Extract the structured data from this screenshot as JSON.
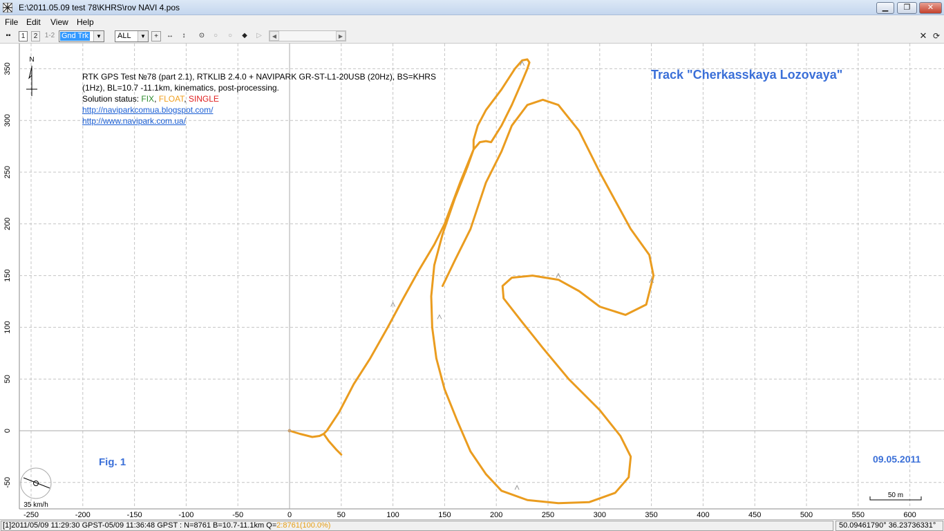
{
  "window": {
    "title": "E:\\2011.05.09 test 78\\KHRS\\rov NAVI 4.pos",
    "icon": "rtkplot-app-icon"
  },
  "menu": {
    "items": [
      "File",
      "Edit",
      "View",
      "Help"
    ]
  },
  "toolbar": {
    "btn1": "1",
    "btn2": "2",
    "btn12": "1-2",
    "plot_type": "Gnd Trk",
    "quality_filter": "ALL",
    "icons": [
      "connect-icon",
      "center-origin-icon",
      "fit-horizontal-icon",
      "fit-vertical-icon",
      "show-track-icon",
      "point-icon",
      "point-icon",
      "point-icon",
      "play-icon"
    ],
    "right_icons": [
      "close-icon",
      "refresh-icon"
    ]
  },
  "annotations": {
    "header_line1": "RTK GPS Test №78 (part 2.1), RTKLIB 2.4.0 + NAVIPARK GR-ST-L1-20USB (20Hz), BS=KHRS",
    "header_line2": "(1Hz), BL=10.7 -11.1km, kinematics, post-processing.",
    "status_label": "Solution status: ",
    "status_fix": "FIX",
    "status_sep1": ", ",
    "status_float": "FLOAT",
    "status_sep2": ", ",
    "status_single": "SINGLE",
    "link1": "http://naviparkcomua.blogspot.com/",
    "link2": "http://www.navipark.com.ua/",
    "track_title": "Track \"Cherkasskaya Lozovaya\"",
    "fig_label": "Fig. 1",
    "date": "09.05.2011",
    "north": "N",
    "speed": "35 km/h",
    "scale": "50 m"
  },
  "colors": {
    "fix": "#2e8b2e",
    "float": "#f0a020",
    "single": "#e02020",
    "track": "#ea9c1f",
    "accent_text": "#3a6fd8",
    "grid": "#c4c4c4"
  },
  "chart_data": {
    "type": "scatter",
    "xlim": [
      -250,
      650
    ],
    "ylim": [
      -70,
      365
    ],
    "x_ticks": [
      -250,
      -200,
      -150,
      -100,
      -50,
      0,
      50,
      100,
      150,
      200,
      250,
      300,
      350,
      400,
      450,
      500,
      550,
      600
    ],
    "y_ticks": [
      -50,
      0,
      50,
      100,
      150,
      200,
      250,
      300,
      350
    ],
    "grid": true,
    "series": [
      {
        "points": [
          [
            0,
            0
          ],
          [
            10,
            -3
          ],
          [
            22,
            -6
          ],
          [
            29,
            -5
          ],
          [
            33,
            -3
          ],
          [
            36,
            0
          ],
          [
            48,
            18
          ],
          [
            62,
            45
          ],
          [
            78,
            70
          ],
          [
            95,
            100
          ],
          [
            110,
            128
          ],
          [
            125,
            155
          ],
          [
            140,
            180
          ],
          [
            150,
            200
          ],
          [
            165,
            240
          ],
          [
            178,
            272
          ],
          [
            184,
            279
          ],
          [
            190,
            280
          ],
          [
            195,
            279
          ],
          [
            205,
            295
          ],
          [
            215,
            315
          ],
          [
            225,
            338
          ],
          [
            230,
            350
          ],
          [
            232,
            356
          ],
          [
            230,
            359
          ],
          [
            225,
            358
          ],
          [
            218,
            350
          ],
          [
            205,
            330
          ],
          [
            190,
            310
          ],
          [
            182,
            295
          ],
          [
            178,
            281
          ],
          [
            178,
            272
          ],
          [
            172,
            255
          ],
          [
            160,
            225
          ],
          [
            148,
            190
          ],
          [
            140,
            160
          ],
          [
            137,
            130
          ],
          [
            138,
            100
          ],
          [
            142,
            70
          ],
          [
            150,
            40
          ],
          [
            162,
            10
          ],
          [
            175,
            -20
          ],
          [
            190,
            -42
          ],
          [
            205,
            -58
          ],
          [
            230,
            -67
          ],
          [
            260,
            -70
          ],
          [
            290,
            -69
          ],
          [
            315,
            -60
          ],
          [
            328,
            -45
          ],
          [
            330,
            -25
          ],
          [
            320,
            -5
          ],
          [
            300,
            20
          ],
          [
            270,
            50
          ],
          [
            245,
            80
          ],
          [
            225,
            105
          ],
          [
            207,
            128
          ],
          [
            206,
            140
          ],
          [
            215,
            148
          ],
          [
            235,
            150
          ],
          [
            260,
            146
          ],
          [
            280,
            135
          ],
          [
            300,
            120
          ],
          [
            325,
            112
          ],
          [
            345,
            122
          ],
          [
            352,
            150
          ],
          [
            348,
            170
          ],
          [
            330,
            195
          ],
          [
            300,
            250
          ],
          [
            280,
            290
          ],
          [
            260,
            315
          ],
          [
            245,
            320
          ],
          [
            230,
            315
          ],
          [
            215,
            295
          ],
          [
            205,
            270
          ],
          [
            190,
            240
          ],
          [
            175,
            195
          ],
          [
            160,
            165
          ],
          [
            148,
            140
          ]
        ]
      },
      {
        "points": [
          [
            33,
            -3
          ],
          [
            38,
            -10
          ],
          [
            45,
            -18
          ],
          [
            50,
            -23
          ]
        ]
      }
    ],
    "direction_markers": [
      [
        225,
        355
      ],
      [
        100,
        122
      ],
      [
        145,
        110
      ],
      [
        260,
        150
      ],
      [
        350,
        145
      ],
      [
        220,
        -55
      ]
    ]
  },
  "status": {
    "left_prefix": "[1]2011/05/09 11:29:30 GPST-05/09 11:36:48 GPST : N=8761 B=10.7-11.1km Q=",
    "left_q": "2:8761(100.0%)",
    "right": "50.09461790°   36.23736331°"
  }
}
